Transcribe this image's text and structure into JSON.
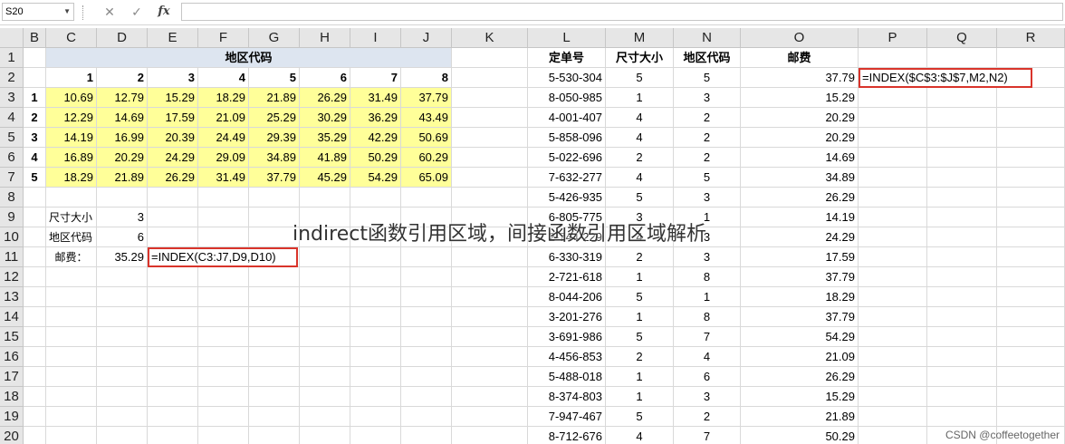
{
  "formula_bar": {
    "name_box": "S20",
    "cancel_glyph": "✕",
    "enter_glyph": "✓",
    "fx_label": "fx"
  },
  "columns": [
    "B",
    "C",
    "D",
    "E",
    "F",
    "G",
    "H",
    "I",
    "J",
    "K",
    "L",
    "M",
    "N",
    "O",
    "P",
    "Q",
    "R"
  ],
  "rows": [
    1,
    2,
    3,
    4,
    5,
    6,
    7,
    8,
    9,
    10,
    11,
    12,
    13,
    14,
    15,
    16,
    17,
    18,
    19,
    20
  ],
  "zone_table": {
    "title": "地区代码",
    "zone_headers": [
      "1",
      "2",
      "3",
      "4",
      "5",
      "6",
      "7",
      "8"
    ],
    "size_labels": [
      "1",
      "2",
      "3",
      "4",
      "5"
    ],
    "values": [
      [
        "10.69",
        "12.79",
        "15.29",
        "18.29",
        "21.89",
        "26.29",
        "31.49",
        "37.79"
      ],
      [
        "12.29",
        "14.69",
        "17.59",
        "21.09",
        "25.29",
        "30.29",
        "36.29",
        "43.49"
      ],
      [
        "14.19",
        "16.99",
        "20.39",
        "24.49",
        "29.39",
        "35.29",
        "42.29",
        "50.69"
      ],
      [
        "16.89",
        "20.29",
        "24.29",
        "29.09",
        "34.89",
        "41.89",
        "50.29",
        "60.29"
      ],
      [
        "18.29",
        "21.89",
        "26.29",
        "31.49",
        "37.79",
        "45.29",
        "54.29",
        "65.09"
      ]
    ]
  },
  "lookup": {
    "size_label": "尺寸大小",
    "size_value": "3",
    "zone_label": "地区代码",
    "zone_value": "6",
    "postage_label": "邮费：",
    "postage_value": "35.29",
    "formula": "=INDEX(C3:J7,D9,D10)"
  },
  "orders": {
    "headers": [
      "定单号",
      "尺寸大小",
      "地区代码",
      "邮费"
    ],
    "formula": "=INDEX($C$3:$J$7,M2,N2)",
    "rows": [
      [
        "5-530-304",
        "5",
        "5",
        "37.79"
      ],
      [
        "8-050-985",
        "1",
        "3",
        "15.29"
      ],
      [
        "4-001-407",
        "4",
        "2",
        "20.29"
      ],
      [
        "5-858-096",
        "4",
        "2",
        "20.29"
      ],
      [
        "5-022-696",
        "2",
        "2",
        "14.69"
      ],
      [
        "7-632-277",
        "4",
        "5",
        "34.89"
      ],
      [
        "5-426-935",
        "5",
        "3",
        "26.29"
      ],
      [
        "6-805-775",
        "3",
        "1",
        "14.19"
      ],
      [
        "2-744-229",
        "4",
        "3",
        "24.29"
      ],
      [
        "6-330-319",
        "2",
        "3",
        "17.59"
      ],
      [
        "2-721-618",
        "1",
        "8",
        "37.79"
      ],
      [
        "8-044-206",
        "5",
        "1",
        "18.29"
      ],
      [
        "3-201-276",
        "1",
        "8",
        "37.79"
      ],
      [
        "3-691-986",
        "5",
        "7",
        "54.29"
      ],
      [
        "4-456-853",
        "2",
        "4",
        "21.09"
      ],
      [
        "5-488-018",
        "1",
        "6",
        "26.29"
      ],
      [
        "8-374-803",
        "1",
        "3",
        "15.29"
      ],
      [
        "7-947-467",
        "5",
        "2",
        "21.89"
      ],
      [
        "8-712-676",
        "4",
        "7",
        "50.29"
      ]
    ]
  },
  "overlay_title": "indirect函数引用区域，间接函数引用区域解析",
  "watermark": "CSDN @coffeetogether",
  "colors": {
    "yellow_fill": "#ffff99",
    "title_fill": "#dde5f0",
    "formula_border": "#d9342b",
    "header_fill": "#e6e6e6"
  }
}
